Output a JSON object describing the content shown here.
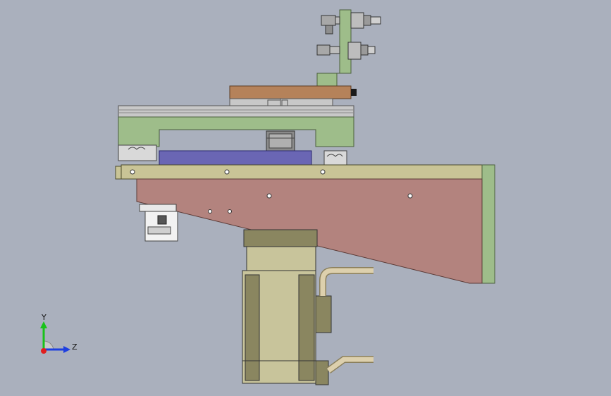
{
  "viewport": {
    "background": "#aab0bd"
  },
  "model": {
    "name": "assembly-side-view",
    "colors": {
      "frame_green": "#9ebd8a",
      "frame_green_dark": "#6f8c5c",
      "plate_olive": "#c9c496",
      "plate_olive_dark": "#8f8a5c",
      "wedge_pink": "#b3837e",
      "slider_brown": "#b5825a",
      "rail_grey": "#c8c8c8",
      "block_blue": "#6a66b4",
      "motor_olive": "#c8c49b",
      "motor_dark": "#8a8660",
      "cable_tan": "#d8c9a3",
      "connector_white": "#f0f0f0",
      "fitting_grey": "#b9b9b9"
    }
  },
  "triad": {
    "y_label": "Y",
    "z_label": "Z",
    "y_color": "#19c219",
    "z_color": "#1e3fe0",
    "x_color": "#e01e1e"
  }
}
